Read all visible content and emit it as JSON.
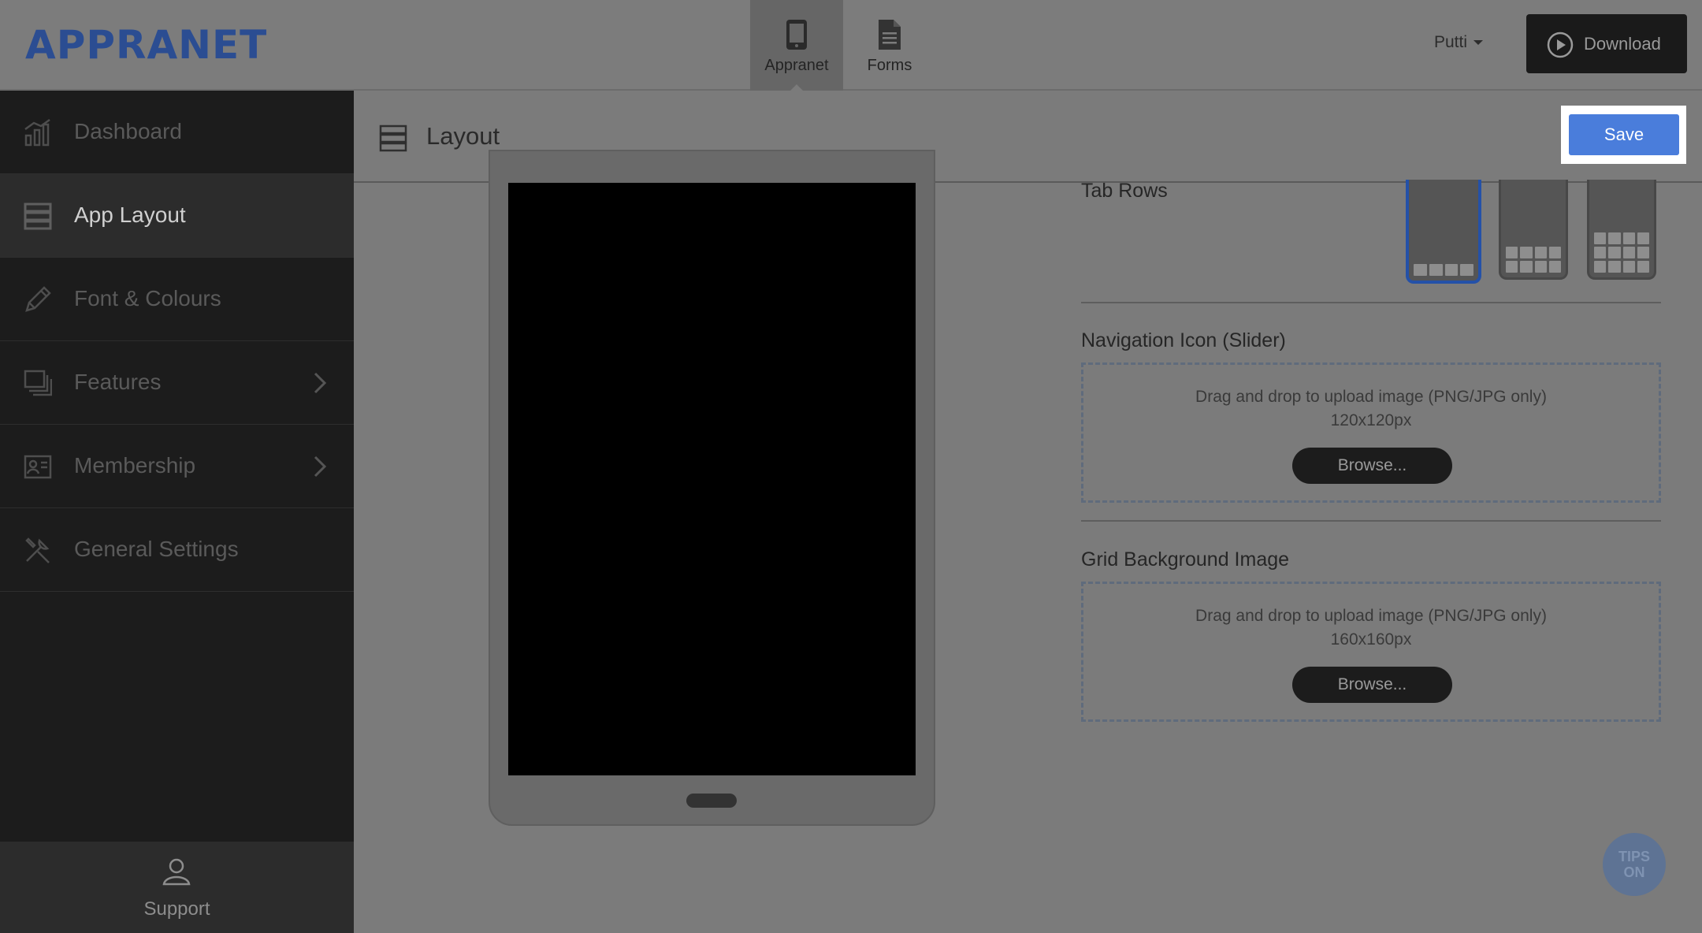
{
  "app": {
    "logo": "APPRANET"
  },
  "header": {
    "tabs": [
      {
        "label": "Appranet",
        "icon": "phone-icon",
        "active": true
      },
      {
        "label": "Forms",
        "icon": "document-icon",
        "active": false
      }
    ],
    "user": "Putti",
    "download_label": "Download"
  },
  "sidebar": {
    "items": [
      {
        "label": "Dashboard",
        "icon": "chart-icon"
      },
      {
        "label": "App Layout",
        "icon": "layout-icon",
        "active": true
      },
      {
        "label": "Font & Colours",
        "icon": "pencil-icon"
      },
      {
        "label": "Features",
        "icon": "features-icon",
        "has_submenu": true
      },
      {
        "label": "Membership",
        "icon": "id-card-icon",
        "has_submenu": true
      },
      {
        "label": "General Settings",
        "icon": "tools-icon"
      }
    ],
    "support_label": "Support"
  },
  "main": {
    "title": "Layout",
    "save_label": "Save",
    "tab_rows": {
      "label": "Tab Rows",
      "options": [
        {
          "rows": 1,
          "selected": true
        },
        {
          "rows": 2,
          "selected": false
        },
        {
          "rows": 3,
          "selected": false
        }
      ]
    },
    "navigation_icon": {
      "label": "Navigation Icon (Slider)",
      "hint": "Drag and drop to upload image (PNG/JPG only)",
      "size": "120x120px",
      "browse_label": "Browse..."
    },
    "grid_background": {
      "label": "Grid Background Image",
      "hint": "Drag and drop to upload image (PNG/JPG only)",
      "size": "160x160px",
      "browse_label": "Browse..."
    }
  },
  "tips": {
    "line1": "TIPS",
    "line2": "ON"
  },
  "colors": {
    "brand": "#2b4d92",
    "save_button": "#4a7ddb",
    "selected_outline": "#2451a8"
  }
}
